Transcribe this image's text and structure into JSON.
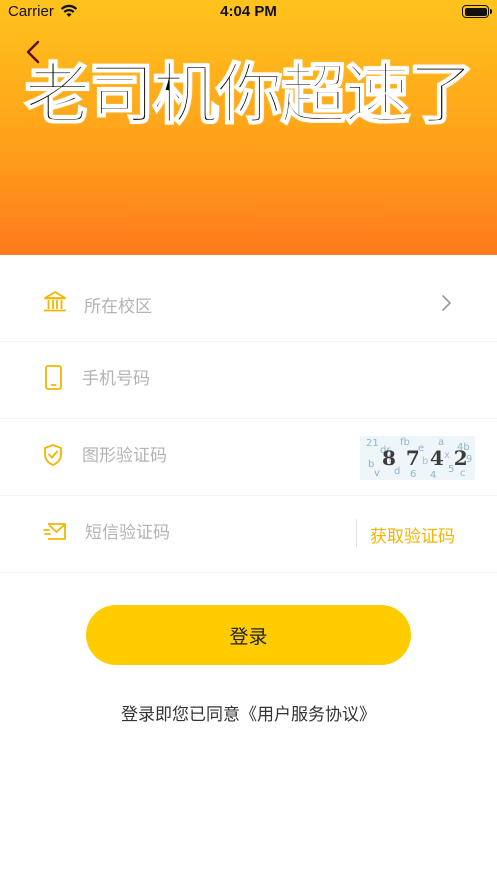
{
  "status_bar": {
    "carrier": "Carrier",
    "time": "4:04 PM"
  },
  "banner": {
    "title": "老司机你超速了"
  },
  "form": {
    "campus": {
      "placeholder": "所在校区",
      "icon": "school-building-icon"
    },
    "phone": {
      "placeholder": "手机号码",
      "icon": "phone-icon"
    },
    "captcha": {
      "placeholder": "图形验证码",
      "icon": "shield-check-icon",
      "code": "8742"
    },
    "sms": {
      "placeholder": "短信验证码",
      "icon": "message-envelope-icon",
      "get_code_label": "获取验证码"
    }
  },
  "login_button": "登录",
  "agreement": {
    "prefix": "登录即您已同意",
    "link": "《用户服务协议》"
  },
  "colors": {
    "accent": "#ffcc00",
    "icon": "#f2b600",
    "banner_top": "#ffc31c",
    "banner_bottom": "#ff7a1c"
  }
}
